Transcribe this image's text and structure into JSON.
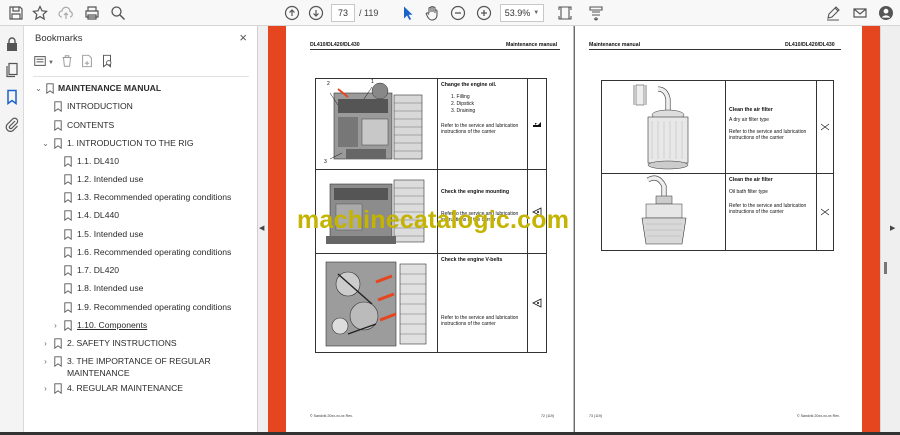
{
  "toolbar": {
    "page_current": "73",
    "page_total": "/ 119",
    "zoom": "53.9%"
  },
  "panel": {
    "title": "Bookmarks",
    "close": "×"
  },
  "bookmarks": [
    {
      "label": "MAINTENANCE MANUAL"
    },
    {
      "label": "INTRODUCTION"
    },
    {
      "label": "CONTENTS"
    },
    {
      "label": "1. INTRODUCTION TO THE RIG"
    },
    {
      "label": "1.1. DL410"
    },
    {
      "label": "1.2. Intended use"
    },
    {
      "label": "1.3. Recommended operating conditions"
    },
    {
      "label": "1.4. DL440"
    },
    {
      "label": "1.5. Intended use"
    },
    {
      "label": "1.6. Recommended operating conditions"
    },
    {
      "label": "1.7. DL420"
    },
    {
      "label": "1.8. Intended use"
    },
    {
      "label": "1.9. Recommended operating conditions"
    },
    {
      "label": "1.10. Components"
    },
    {
      "label": "2. SAFETY INSTRUCTIONS"
    },
    {
      "label": "3. THE IMPORTANCE OF REGULAR",
      "label2": "MAINTENANCE"
    },
    {
      "label": "4. REGULAR MAINTENANCE"
    }
  ],
  "left_page": {
    "header_left": "DL410/DL420/DL430",
    "header_right": "Maintenance manual",
    "footer_left": "© Sandvik 20xx-xx-xx  Rev.",
    "footer_right": "72 (119)",
    "rows": [
      {
        "title": "Change the engine oil.",
        "items": [
          "1.   Filling",
          "2.   Dipstick",
          "3.   Draining"
        ],
        "note": "Refer to the service and lubrication instructions of the carrier"
      },
      {
        "title": "Check the engine mounting",
        "note": "Refer to the service and lubrication instructions of the carrier"
      },
      {
        "title": "Check the engine V-belts",
        "note": "Refer to the service and lubrication instructions of the carrier"
      }
    ],
    "callouts": [
      "2",
      "1",
      "3"
    ]
  },
  "right_page": {
    "header_left": "Maintenance manual",
    "header_right": "DL410/DL420/DL430",
    "footer_left": "73 (119)",
    "footer_right": "© Sandvik 20xx-xx-xx  Rev.",
    "rows": [
      {
        "title": "Clean the air filter",
        "sub": "A dry air filter type",
        "note": "Refer to the service and lubrication instructions of the carrier"
      },
      {
        "title": "Clean the air filter",
        "sub": "Oil bath filter type",
        "note": "Refer to the service and lubrication instructions of the carrier"
      }
    ]
  },
  "watermark": "machinecatalogic.com"
}
